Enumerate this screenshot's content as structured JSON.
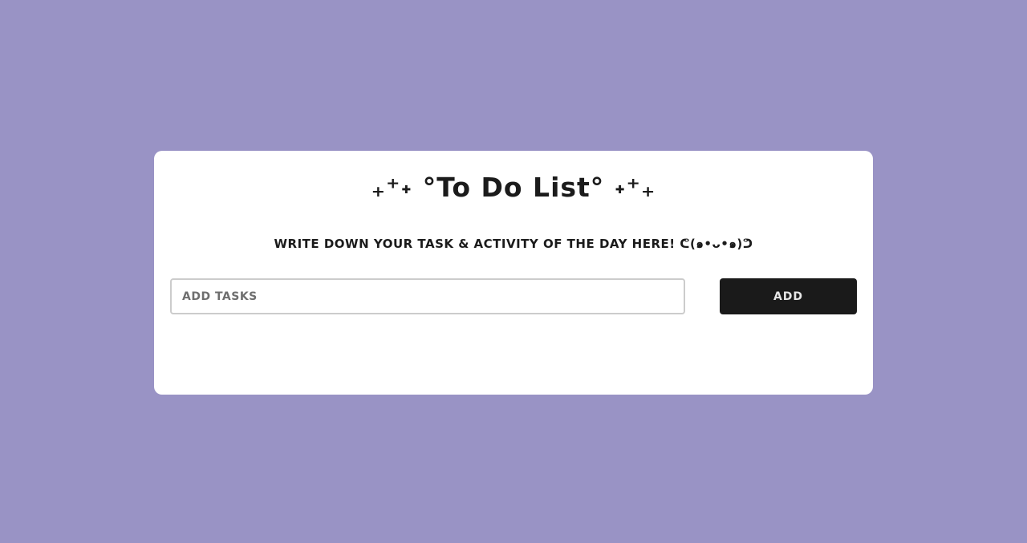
{
  "page": {
    "background_color": "#9993c5"
  },
  "card": {
    "title": "₊⁺˖ °To Do List° ˖⁺₊",
    "subtitle": "WRITE DOWN YOUR TASK & ACTIVITY OF THE DAY HERE! ᕦ(๑•ᴗ•๑)ᕤ",
    "background_color": "#ffffff"
  },
  "task_input": {
    "placeholder": "ADD TASKS",
    "value": ""
  },
  "add_button": {
    "label": "ADD",
    "background_color": "#1a1a1a"
  },
  "tasks": []
}
